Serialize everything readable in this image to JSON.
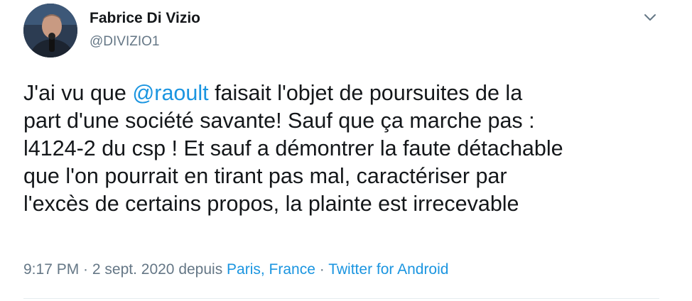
{
  "author": {
    "name": "Fabrice Di Vizio",
    "handle": "@DIVIZIO1"
  },
  "tweet": {
    "line1_before": "J'ai vu que ",
    "mention": "@raoult",
    "line1_after": " faisait l'objet de poursuites de la",
    "line2": "part d'une société savante! Sauf que ça marche pas :",
    "line3": "l4124-2 du csp ! Et sauf a démontrer la faute détachable",
    "line4": "que l'on pourrait en tirant pas mal, caractériser par",
    "line5": "l'excès de certains propos, la plainte est irrecevable"
  },
  "meta": {
    "time": "9:17 PM",
    "sep1": " · ",
    "date": "2 sept. 2020",
    "from": " depuis ",
    "location": "Paris, France",
    "sep2": " · ",
    "source": "Twitter for Android"
  },
  "icons": {
    "caret": "chevron-down-icon",
    "avatar": "profile-photo"
  },
  "colors": {
    "link": "#1b95e0",
    "text": "#14171a",
    "secondary": "#657786",
    "divider": "#e6ecf0"
  }
}
